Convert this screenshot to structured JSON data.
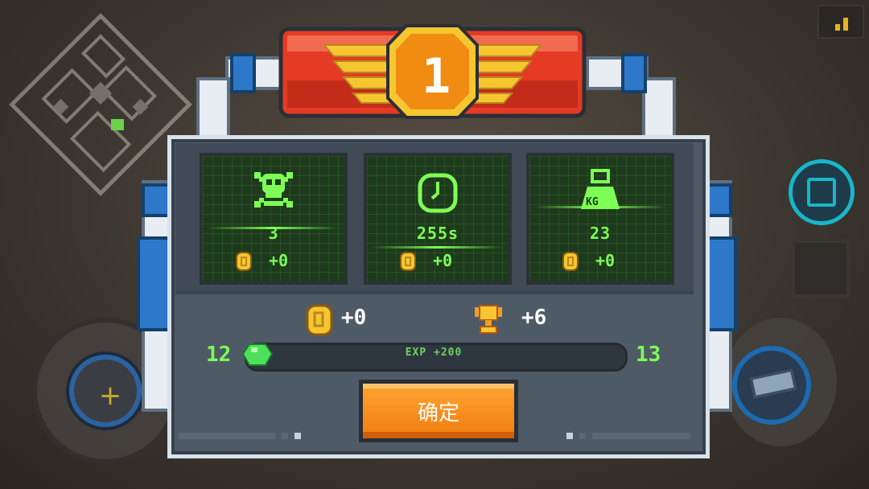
{
  "hud": {
    "minimap_icon": "minimap-icon",
    "signal_icon": "signal-bars-icon",
    "move_joystick_icon": "plus-icon",
    "aim_button_icon": "crosshair-icon",
    "weapon_icon": "gun-icon"
  },
  "banner": {
    "rank": "1",
    "colors": {
      "banner": "#e53a24",
      "wing": "#f5c630",
      "medal": "#f08c12"
    }
  },
  "stats": [
    {
      "icon": "skull-icon",
      "value": "3",
      "coin_icon": "coin-icon",
      "reward": "+0"
    },
    {
      "icon": "clock-icon",
      "value": "255s",
      "coin_icon": "coin-icon",
      "reward": "+0"
    },
    {
      "icon": "weight-icon",
      "icon_label": "KG",
      "value": "23",
      "coin_icon": "coin-icon",
      "reward": "+0"
    }
  ],
  "totals": {
    "coins_icon": "coin-icon",
    "coins_reward": "+0",
    "trophy_icon": "trophy-icon",
    "trophy_reward": "+6"
  },
  "experience": {
    "level_current": "12",
    "level_next": "13",
    "label": "EXP +200",
    "gem_icon": "gem-icon",
    "progress": 0.03,
    "color": "#7dff55"
  },
  "confirm_label": "确定"
}
